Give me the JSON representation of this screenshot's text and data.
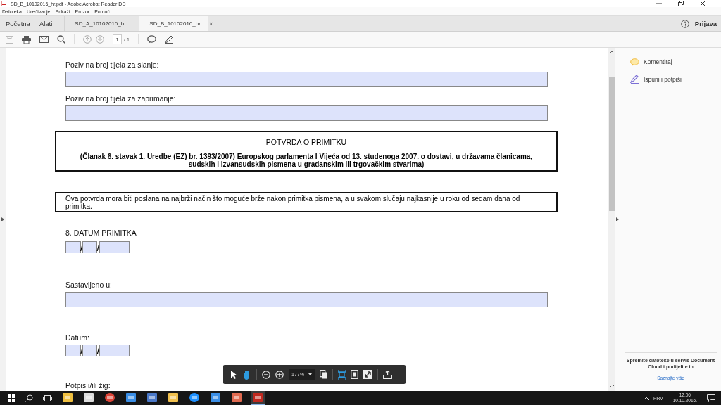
{
  "window": {
    "title": "SD_B_10102016_hr.pdf - Adobe Acrobat Reader DC"
  },
  "menu": [
    "Datoteka",
    "Uređivanje",
    "Prikaži",
    "Prozor",
    "Pomoć"
  ],
  "nav": [
    "Početna",
    "Alati"
  ],
  "tabs": [
    {
      "label": "SD_A_10102016_h...",
      "selected": false
    },
    {
      "label": "SD_B_10102016_hr...",
      "selected": true,
      "close": "×"
    }
  ],
  "account": "Prijava",
  "toolbar": {
    "page": "1",
    "total": "/ 1"
  },
  "form": [
    {
      "kind": "label",
      "text": "Poziv na broj tijela za slanje:"
    },
    {
      "kind": "field"
    },
    {
      "kind": "label",
      "text": "Poziv na broj tijela za zaprimanje:"
    },
    {
      "kind": "field"
    },
    {
      "kind": "heading",
      "title": "POTVRDA O PRIMITKU",
      "text": "(Članak 6. stavak 1. Uredbe (EZ) br. 1393/2007) Europskog parlamenta I Vijeća od 13. studenoga 2007. o dostavi, u državama članicama, sudskih i izvansudskih pismena u građanskim ili trgovačkim stvarima)"
    },
    {
      "kind": "notice",
      "text": "Ova potvrda mora biti poslana na najbrži način što moguće brže nakon primitka pismena, a u svakom slučaju najkasnije u roku od sedam dana od primitka."
    },
    {
      "kind": "label",
      "text": "8. DATUM PRIMITKA"
    },
    {
      "kind": "date",
      "separators": [
        "/",
        "/"
      ]
    },
    {
      "kind": "label",
      "text": "Sastavljeno u:"
    },
    {
      "kind": "field"
    },
    {
      "kind": "label",
      "text": "Datum:"
    },
    {
      "kind": "date",
      "separators": [
        "/",
        "/"
      ]
    },
    {
      "kind": "label",
      "text": "Potpis i/ili žig:"
    }
  ],
  "float_tools": [
    {
      "kind": "pointer",
      "selected": false
    },
    {
      "kind": "hand",
      "selected": true
    },
    {
      "kind": "zoom-out"
    },
    {
      "kind": "zoom-in"
    },
    {
      "kind": "zoom",
      "value": "177%"
    },
    {
      "kind": "pages"
    },
    {
      "kind": "fit-width",
      "selected": true
    },
    {
      "kind": "fit-page",
      "selected": false
    },
    {
      "kind": "fullscreen",
      "selected": false
    },
    {
      "kind": "share"
    }
  ],
  "panel": {
    "items": [
      {
        "kind": "comment",
        "label": "Komentiraj"
      },
      {
        "kind": "sign",
        "label": "Ispuni i potpiši"
      }
    ],
    "promo": "Spremite datoteke u servis Document Cloud i podijelite ih",
    "link": "Saznajte više"
  },
  "taskbar": {
    "language": "HRV",
    "time": "12:06",
    "date": "10.10.2016."
  }
}
